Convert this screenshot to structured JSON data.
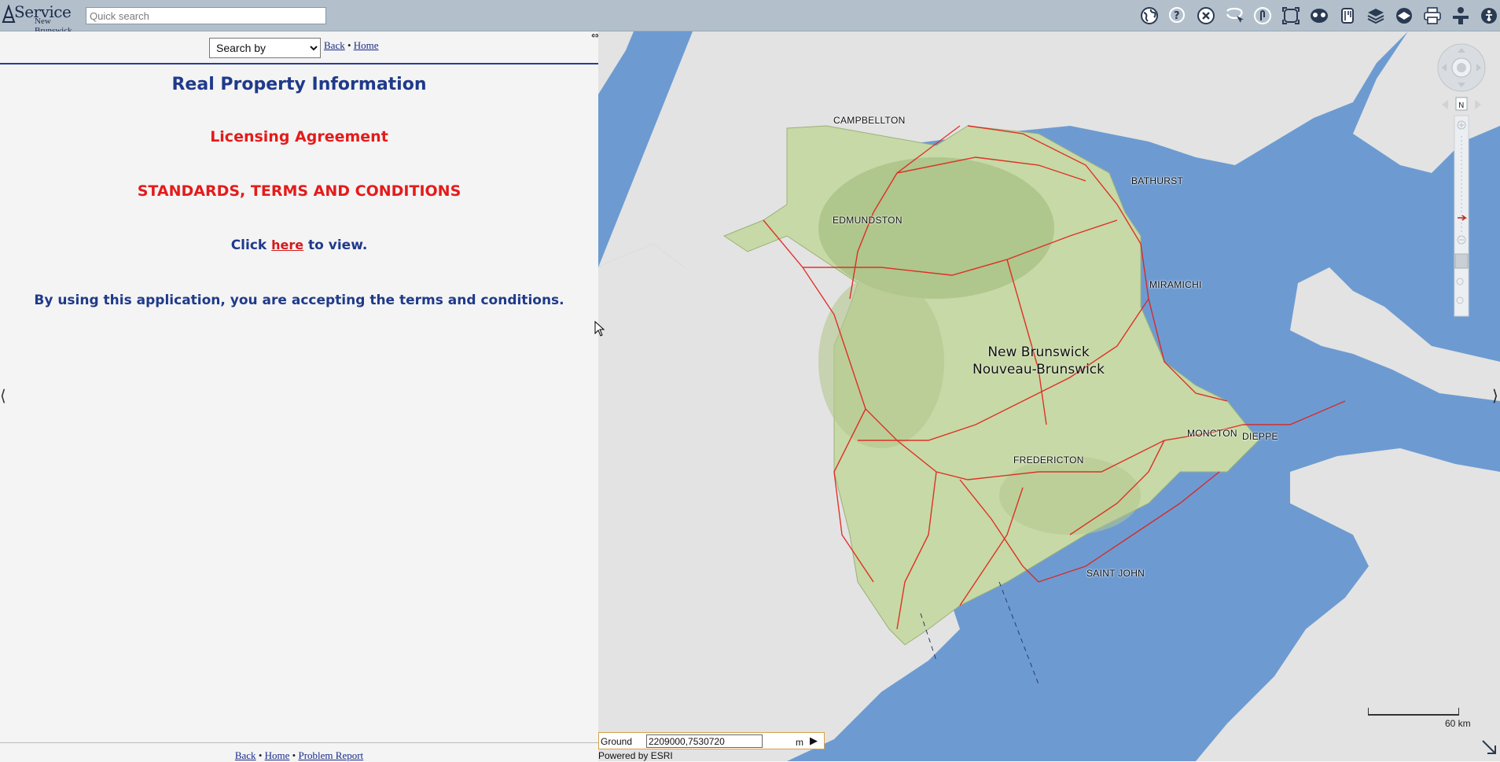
{
  "header": {
    "logo_service": "Service",
    "logo_region": "New Brunswick",
    "search_placeholder": "Quick search",
    "tools": [
      "globe-icon",
      "identify-help-icon",
      "clear-icon",
      "select-icon",
      "touch-icon",
      "extent-icon",
      "overview-icon",
      "measure-icon",
      "layers-icon",
      "basemap-icon",
      "print-icon",
      "help-person-icon",
      "accessibility-icon"
    ]
  },
  "nav": {
    "search_select": "Search by",
    "back": "Back",
    "separator": "•",
    "home": "Home"
  },
  "content": {
    "title": "Real Property Information",
    "licensing": "Licensing Agreement",
    "standards": "STANDARDS, TERMS AND CONDITIONS",
    "click_prefix": "Click ",
    "click_link": "here",
    "click_suffix": " to view.",
    "accept": "By using this application, you are accepting the terms and conditions."
  },
  "footer": {
    "back": "Back",
    "separator": "•",
    "home": "Home",
    "problem": "Problem Report"
  },
  "map": {
    "province_en": "New Brunswick",
    "province_fr": "Nouveau-Brunswick",
    "cities": [
      "CAMPBELLTON",
      "BATHURST",
      "EDMUNDSTON",
      "MIRAMICHI",
      "MONCTON",
      "DIEPPE",
      "FREDERICTON",
      "SAINT JOHN"
    ],
    "coord_label": "Ground",
    "coord_value": "2209000,7530720",
    "coord_unit": "m",
    "powered_by": "Powered by ESRI",
    "scale_label": "60 km",
    "colors": {
      "water": "#6d9bd1",
      "land": "#e3e3e3",
      "province": "#c7d9a6",
      "roads": "#e0201a"
    }
  }
}
